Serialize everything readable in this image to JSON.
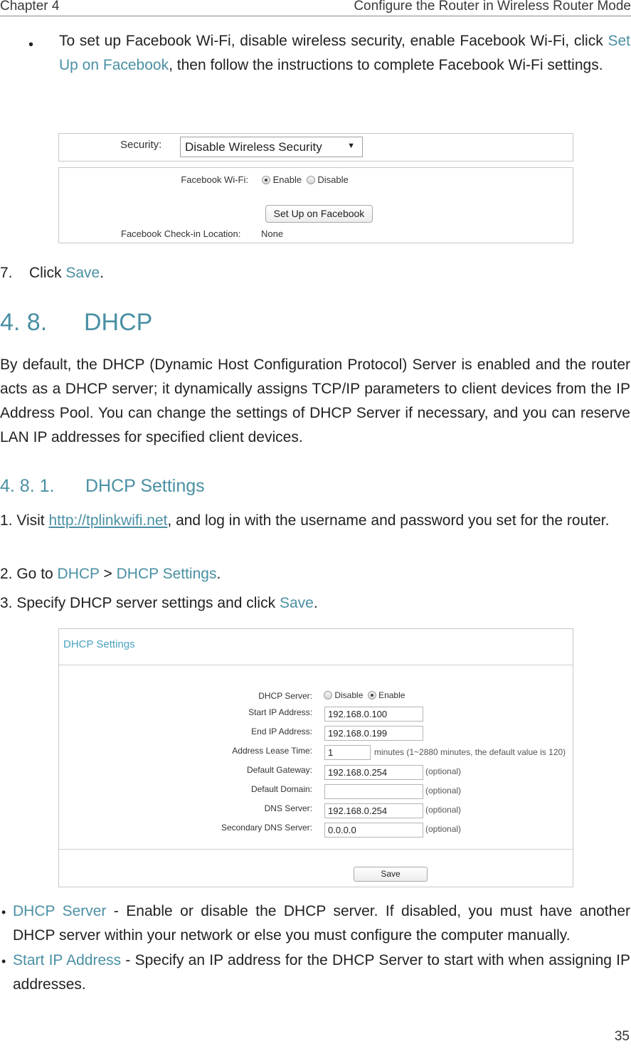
{
  "header": {
    "chapter": "Chapter 4",
    "title": "Configure the Router in Wireless Router Mode"
  },
  "intro_bullet": {
    "text_before": "To set up Facebook Wi-Fi, disable wireless security, enable Facebook Wi-Fi, click ",
    "link": "Set Up on Facebook",
    "text_after": ", then follow the instructions to complete Facebook Wi-Fi settings."
  },
  "facebook_screenshot": {
    "security_label": "Security:",
    "security_value": "Disable Wireless Security",
    "facebook_wifi_label": "Facebook Wi-Fi:",
    "enable_label": "Enable",
    "disable_label": "Disable",
    "selected": "Enable",
    "setup_button": "Set Up on Facebook",
    "checkin_label": "Facebook Check-in Location:",
    "checkin_value": "None"
  },
  "step7": {
    "number": "7.",
    "text": "Click ",
    "link": "Save",
    "end": "."
  },
  "section": {
    "number": "4. 8.",
    "title": "DHCP",
    "paragraph": "By default, the DHCP (Dynamic Host Configuration Protocol) Server is enabled and the router acts as a DHCP server; it dynamically assigns TCP/IP parameters to client devices from the IP Address Pool. You can change the settings of DHCP Server if necessary, and you can reserve LAN IP addresses for specified client devices."
  },
  "subsection": {
    "number": "4. 8. 1.",
    "title": "DHCP Settings"
  },
  "steps": [
    {
      "prefix": "1. Visit ",
      "link": "http://tplinkwifi.net",
      "suffix": ", and log in with the username and password you set for the router."
    },
    {
      "prefix": "2. Go to ",
      "link1": "DHCP",
      "sep": " > ",
      "link2": "DHCP Settings",
      "suffix": "."
    },
    {
      "prefix": "3. Specify DHCP server settings and click ",
      "link": "Save",
      "suffix": "."
    }
  ],
  "dhcp_screenshot": {
    "title": "DHCP Settings",
    "server_label": "DHCP Server:",
    "disable_label": "Disable",
    "enable_label": "Enable",
    "selected": "Enable",
    "fields": [
      {
        "label": "Start IP Address:",
        "value": "192.168.0.100",
        "note": ""
      },
      {
        "label": "End IP Address:",
        "value": "192.168.0.199",
        "note": ""
      },
      {
        "label": "Address Lease Time:",
        "value": "1",
        "note": "minutes (1~2880 minutes, the default value is 120)"
      },
      {
        "label": "Default Gateway:",
        "value": "192.168.0.254",
        "note": "(optional)"
      },
      {
        "label": "Default Domain:",
        "value": "",
        "note": "(optional)"
      },
      {
        "label": "DNS Server:",
        "value": "192.168.0.254",
        "note": "(optional)"
      },
      {
        "label": "Secondary DNS Server:",
        "value": "0.0.0.0",
        "note": "(optional)"
      }
    ],
    "save_button": "Save"
  },
  "descriptions": [
    {
      "term": "DHCP Server",
      "text": " - Enable or disable the DHCP server. If disabled, you must have another DHCP server within your network or else you must configure the computer manually."
    },
    {
      "term": "Start IP Address",
      "text": " - Specify an IP address for the DHCP Server to start with when assigning IP addresses."
    }
  ],
  "page_number": "35"
}
